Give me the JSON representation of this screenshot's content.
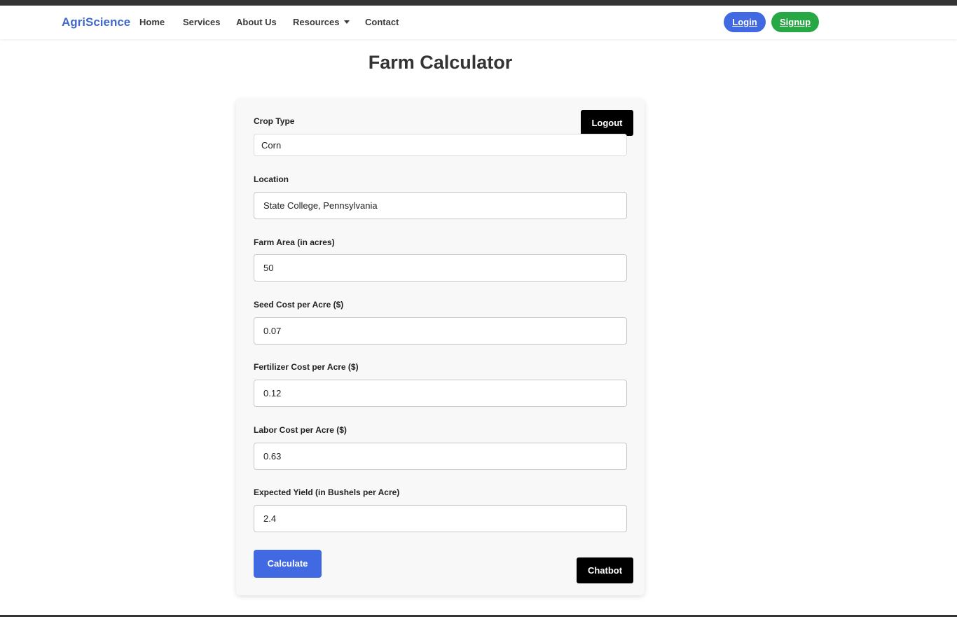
{
  "navbar": {
    "brand": "AgriScience",
    "links": {
      "home": "Home",
      "services": "Services",
      "about": "About Us",
      "resources": "Resources",
      "contact": "Contact"
    },
    "login_label": "Login",
    "signup_label": "Signup"
  },
  "page": {
    "title": "Farm Calculator"
  },
  "form": {
    "logout_label": "Logout",
    "crop_type": {
      "label": "Crop Type",
      "value": "Corn"
    },
    "location": {
      "label": "Location",
      "value": "State College, Pennsylvania"
    },
    "farm_area": {
      "label": "Farm Area (in acres)",
      "value": "50"
    },
    "seed_cost": {
      "label": "Seed Cost per Acre ($)",
      "value": "0.07"
    },
    "fertilizer_cost": {
      "label": "Fertilizer Cost per Acre ($)",
      "value": "0.12"
    },
    "labor_cost": {
      "label": "Labor Cost per Acre ($)",
      "value": "0.63"
    },
    "expected_yield": {
      "label": "Expected Yield (in Bushels per Acre)",
      "value": "2.4"
    },
    "calculate_label": "Calculate",
    "chatbot_label": "Chatbot"
  },
  "colors": {
    "brand": "#4169c9",
    "primary_button": "#4169e1",
    "signup_button": "#28a745",
    "dark_button": "#000000"
  },
  "icons": {
    "resources_dropdown": "caret-down-icon"
  }
}
